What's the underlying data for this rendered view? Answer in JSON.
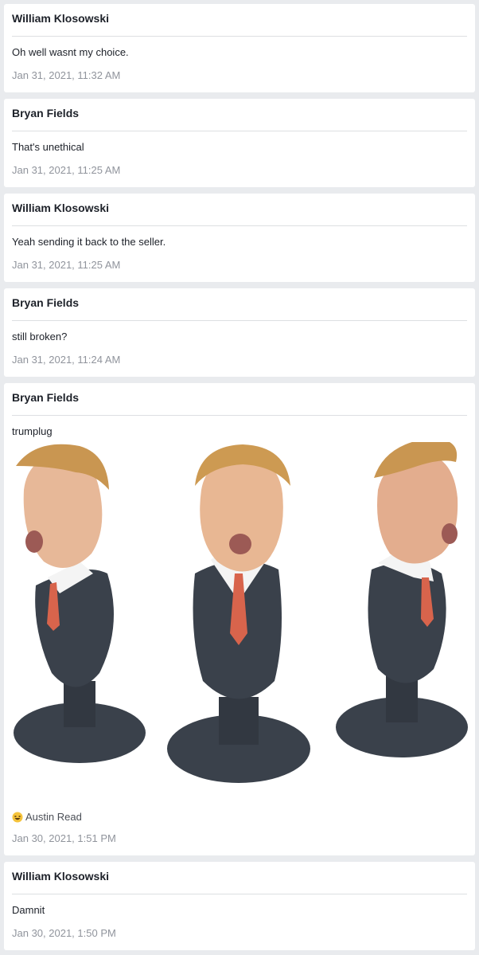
{
  "messages": [
    {
      "author": "William Klosowski",
      "text": "Oh well wasnt my choice.",
      "time": "Jan 31, 2021, 11:32 AM"
    },
    {
      "author": "Bryan Fields",
      "text": "That's unethical",
      "time": "Jan 31, 2021, 11:25 AM"
    },
    {
      "author": "William Klosowski",
      "text": "Yeah sending it back to the seller.",
      "time": "Jan 31, 2021, 11:25 AM"
    },
    {
      "author": "Bryan Fields",
      "text": "still broken?",
      "time": "Jan 31, 2021, 11:24 AM"
    },
    {
      "author": "Bryan Fields",
      "text": "trumplug",
      "time": "Jan 30, 2021, 1:51 PM",
      "reaction": {
        "icon": "laughing-emoji-icon",
        "name": "Austin Read"
      }
    },
    {
      "author": "William Klosowski",
      "text": "Damnit",
      "time": "Jan 30, 2021, 1:50 PM"
    }
  ],
  "colors": {
    "background": "#e9ebee",
    "card": "#ffffff",
    "timestamp": "#90949c",
    "suit": "#3a414b",
    "tie": "#d8644c"
  }
}
